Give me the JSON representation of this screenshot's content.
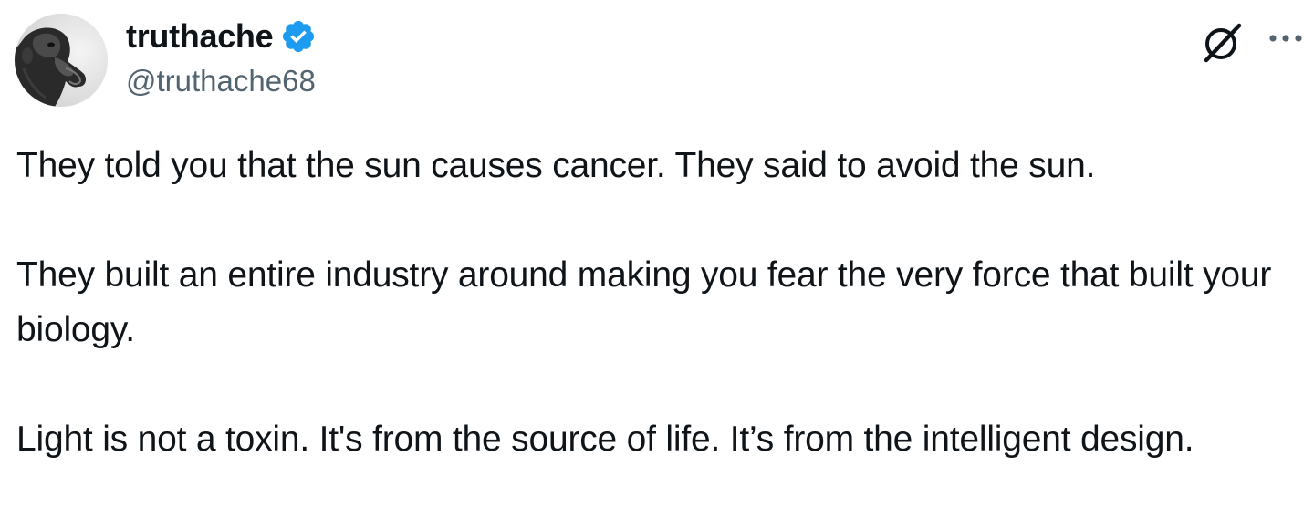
{
  "author": {
    "display_name": "truthache",
    "handle": "@truthache68",
    "verified": true,
    "verified_color": "#1d9bf0"
  },
  "icons": {
    "grok": "grok-icon",
    "more": "more-dots-icon",
    "verified": "verified-badge-icon"
  },
  "tweet": {
    "paragraphs": [
      "They told you that the sun causes cancer. They said to avoid the sun.",
      "They built an entire industry around making you fear the very force that built your biology.",
      "Light is not a toxin. It's from the source of life. It’s from the intelligent design."
    ]
  },
  "colors": {
    "text": "#0f1419",
    "secondary_text": "#536471",
    "background": "#ffffff"
  }
}
